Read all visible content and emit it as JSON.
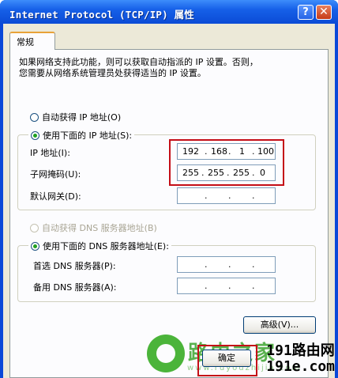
{
  "window": {
    "title": "Internet Protocol (TCP/IP) 属性",
    "help": "?",
    "close": "✕"
  },
  "tab": {
    "label": "常规"
  },
  "description": {
    "line1": "如果网络支持此功能，则可以获取自动指派的 IP 设置。否则，",
    "line2": "您需要从网络系统管理员处获得适当的 IP 设置。"
  },
  "ip": {
    "auto_label": "自动获得 IP 地址(O)",
    "manual_label": "使用下面的 IP 地址(S):",
    "address_label": "IP 地址(I):",
    "address": [
      "192",
      "168",
      "1",
      "100"
    ],
    "mask_label": "子网掩码(U):",
    "mask": [
      "255",
      "255",
      "255",
      "0"
    ],
    "gateway_label": "默认网关(D):"
  },
  "dns": {
    "auto_label": "自动获得 DNS 服务器地址(B)",
    "manual_label": "使用下面的 DNS 服务器地址(E):",
    "preferred_label": "首选 DNS 服务器(P):",
    "alternate_label": "备用 DNS 服务器(A):"
  },
  "buttons": {
    "advanced": "高级(V)...",
    "ok": "确定"
  },
  "watermark": {
    "logo_text": "路由之家",
    "site": "www.ruyouzhijia.com",
    "corner1": "191路由网",
    "corner2": "191e.com"
  },
  "colors": {
    "highlight": "#c40e17",
    "accent": "#21a121"
  }
}
